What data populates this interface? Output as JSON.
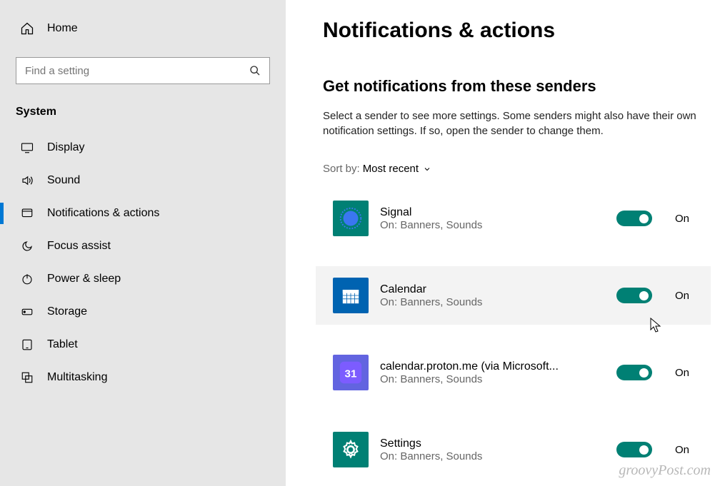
{
  "sidebar": {
    "home": "Home",
    "search_placeholder": "Find a setting",
    "section": "System",
    "items": [
      {
        "id": "display",
        "label": "Display",
        "active": false
      },
      {
        "id": "sound",
        "label": "Sound",
        "active": false
      },
      {
        "id": "notifications",
        "label": "Notifications & actions",
        "active": true
      },
      {
        "id": "focus-assist",
        "label": "Focus assist",
        "active": false
      },
      {
        "id": "power-sleep",
        "label": "Power & sleep",
        "active": false
      },
      {
        "id": "storage",
        "label": "Storage",
        "active": false
      },
      {
        "id": "tablet",
        "label": "Tablet",
        "active": false
      },
      {
        "id": "multitasking",
        "label": "Multitasking",
        "active": false
      }
    ]
  },
  "main": {
    "title": "Notifications & actions",
    "subtitle": "Get notifications from these senders",
    "description": "Select a sender to see more settings. Some senders might also have their own notification settings. If so, open the sender to change them.",
    "sort_label": "Sort by:",
    "sort_value": "Most recent",
    "toggle_state_label": "On",
    "senders": [
      {
        "name": "Signal",
        "sub": "On: Banners, Sounds",
        "icon_bg": "#008074",
        "icon": "signal",
        "hover": false
      },
      {
        "name": "Calendar",
        "sub": "On: Banners, Sounds",
        "icon_bg": "#0063b1",
        "icon": "calendar",
        "hover": true
      },
      {
        "name": "calendar.proton.me (via Microsoft...",
        "sub": "On: Banners, Sounds",
        "icon_bg": "#6264e0",
        "icon": "proton",
        "hover": false
      },
      {
        "name": "Settings",
        "sub": "On: Banners, Sounds",
        "icon_bg": "#008074",
        "icon": "gear",
        "hover": false
      }
    ]
  },
  "watermark": "groovyPost.com"
}
